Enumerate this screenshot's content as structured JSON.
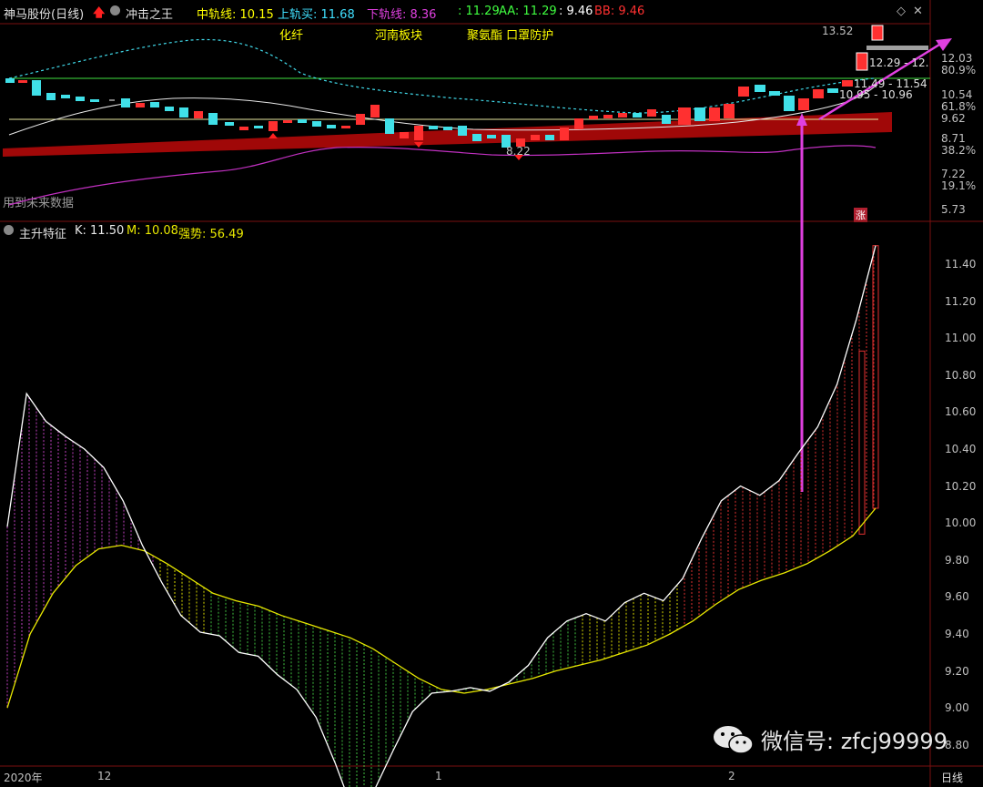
{
  "header": {
    "stock_name": "神马股份(日线)",
    "indicator_name": "冲击之王",
    "mid_label": "中轨线: 10.15",
    "upper_label": "上轨买: 11.68",
    "lower_label": "下轨线: 8.36",
    "extra_label": ": 11.29",
    "aa_label": "AA: 11.29",
    "val_label": ": 9.46",
    "bb_label": "BB: 9.46"
  },
  "sectors": [
    "化纤",
    "河南板块",
    "聚氨酯 口罩防护"
  ],
  "future_data_label": "用到未来数据",
  "badge_label": "涨",
  "annotations": {
    "high_price": "13.52",
    "low_price": "8.22",
    "range_1": "12.29 - 12.",
    "range_2": "11.49 - 11.54",
    "range_3": "10.95 - 10.96"
  },
  "main_axis": [
    "12.03",
    "80.9%",
    "10.54",
    "61.8%",
    "9.62",
    "8.71",
    "38.2%",
    "7.22",
    "19.1%",
    "5.73"
  ],
  "sub_header": {
    "name": "主升特征",
    "k_label": "K: 11.50",
    "m_label": "M: 10.08",
    "strength_label": "强势: 56.49"
  },
  "chart_data": {
    "type": "line",
    "title": "主升特征",
    "series": [
      {
        "name": "K",
        "values": [
          9.98,
          10.7,
          10.55,
          10.47,
          10.4,
          10.3,
          10.12,
          9.88,
          9.68,
          9.5,
          9.41,
          9.39,
          9.3,
          9.28,
          9.18,
          9.1,
          8.95,
          8.7,
          8.42,
          8.55,
          8.77,
          8.98,
          9.08,
          9.09,
          9.11,
          9.09,
          9.14,
          9.23,
          9.38,
          9.47,
          9.51,
          9.47,
          9.57,
          9.62,
          9.58,
          9.7,
          9.92,
          10.12,
          10.2,
          10.15,
          10.23,
          10.38,
          10.52,
          10.75,
          11.1,
          11.5
        ]
      },
      {
        "name": "M",
        "values": [
          9.0,
          9.4,
          9.62,
          9.77,
          9.86,
          9.88,
          9.85,
          9.78,
          9.7,
          9.62,
          9.58,
          9.55,
          9.5,
          9.46,
          9.42,
          9.38,
          9.32,
          9.24,
          9.16,
          9.1,
          9.08,
          9.1,
          9.13,
          9.16,
          9.2,
          9.23,
          9.26,
          9.3,
          9.34,
          9.4,
          9.47,
          9.56,
          9.64,
          9.69,
          9.73,
          9.78,
          9.85,
          9.93,
          10.08
        ]
      }
    ],
    "ylim": [
      8.75,
      11.6
    ],
    "y_ticks": [
      "11.40",
      "11.20",
      "11.00",
      "10.80",
      "10.60",
      "10.40",
      "10.20",
      "10.00",
      "9.80",
      "9.60",
      "9.40",
      "9.20",
      "9.00",
      "8.80"
    ],
    "x_ticks": [
      "2020年",
      "12",
      "1",
      "2"
    ],
    "period_label": "日线",
    "colors": {
      "K": "#ffffff",
      "M": "#e8e800",
      "purple": "#c040c0",
      "green": "#40c040",
      "red": "#e03030",
      "yellow": "#d8d800"
    }
  },
  "watermark": "微信号: zfcj99999"
}
